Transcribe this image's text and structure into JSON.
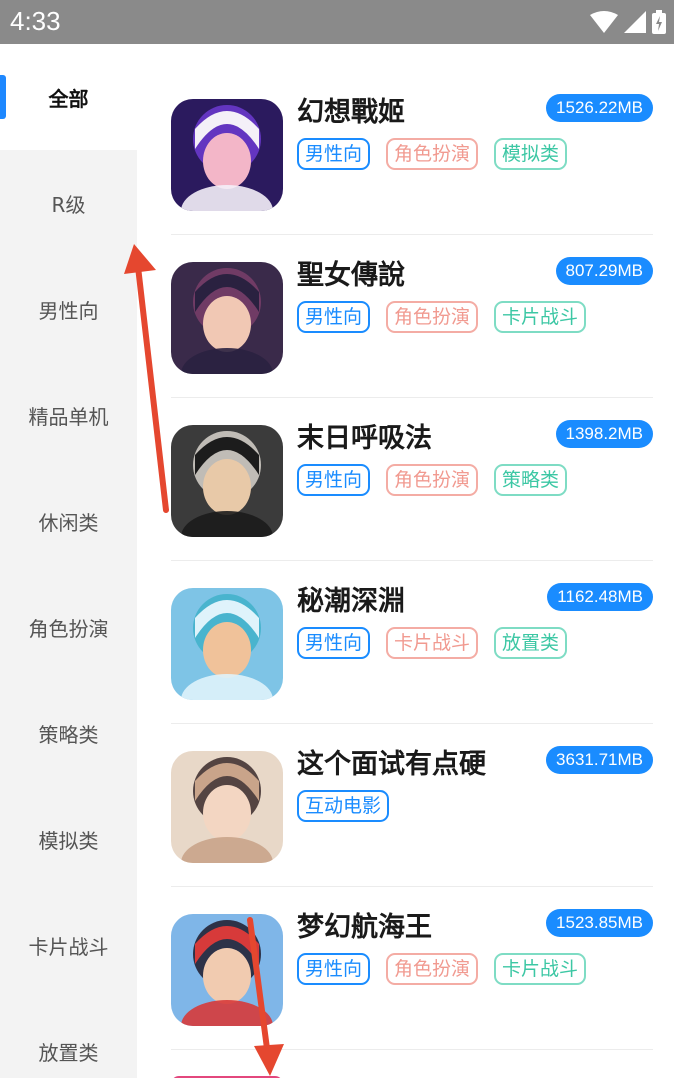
{
  "status_bar": {
    "time": "4:33"
  },
  "colors": {
    "accent": "#1a8cff",
    "tag_blue": "#1a8cff",
    "tag_red": "#f19a90",
    "tag_green": "#3cc7a4",
    "annotation_arrow": "#e5472f"
  },
  "sidebar": {
    "active_index": 0,
    "items": [
      {
        "label": "全部"
      },
      {
        "label": "R级"
      },
      {
        "label": "男性向"
      },
      {
        "label": "精品单机"
      },
      {
        "label": "休闲类"
      },
      {
        "label": "角色扮演"
      },
      {
        "label": "策略类"
      },
      {
        "label": "模拟类"
      },
      {
        "label": "卡片战斗"
      },
      {
        "label": "放置类"
      }
    ]
  },
  "games": [
    {
      "name": "幻想戰姬",
      "size": "1526.22MB",
      "icon": "game-art-icon",
      "tags": [
        {
          "label": "男性向",
          "color": "blue"
        },
        {
          "label": "角色扮演",
          "color": "red"
        },
        {
          "label": "模拟类",
          "color": "green"
        }
      ]
    },
    {
      "name": "聖女傳說",
      "size": "807.29MB",
      "icon": "game-art-icon",
      "tags": [
        {
          "label": "男性向",
          "color": "blue"
        },
        {
          "label": "角色扮演",
          "color": "red"
        },
        {
          "label": "卡片战斗",
          "color": "green"
        }
      ]
    },
    {
      "name": "末日呼吸法",
      "size": "1398.2MB",
      "icon": "game-art-icon",
      "tags": [
        {
          "label": "男性向",
          "color": "blue"
        },
        {
          "label": "角色扮演",
          "color": "red"
        },
        {
          "label": "策略类",
          "color": "green"
        }
      ]
    },
    {
      "name": "秘潮深淵",
      "size": "1162.48MB",
      "icon": "game-art-icon",
      "tags": [
        {
          "label": "男性向",
          "color": "blue"
        },
        {
          "label": "卡片战斗",
          "color": "red"
        },
        {
          "label": "放置类",
          "color": "green"
        }
      ]
    },
    {
      "name": "这个面试有点硬",
      "size": "3631.71MB",
      "icon": "game-art-icon",
      "tags": [
        {
          "label": "互动电影",
          "color": "blue"
        }
      ]
    },
    {
      "name": "梦幻航海王",
      "size": "1523.85MB",
      "icon": "game-art-icon",
      "tags": [
        {
          "label": "男性向",
          "color": "blue"
        },
        {
          "label": "角色扮演",
          "color": "red"
        },
        {
          "label": "卡片战斗",
          "color": "green"
        }
      ]
    }
  ]
}
